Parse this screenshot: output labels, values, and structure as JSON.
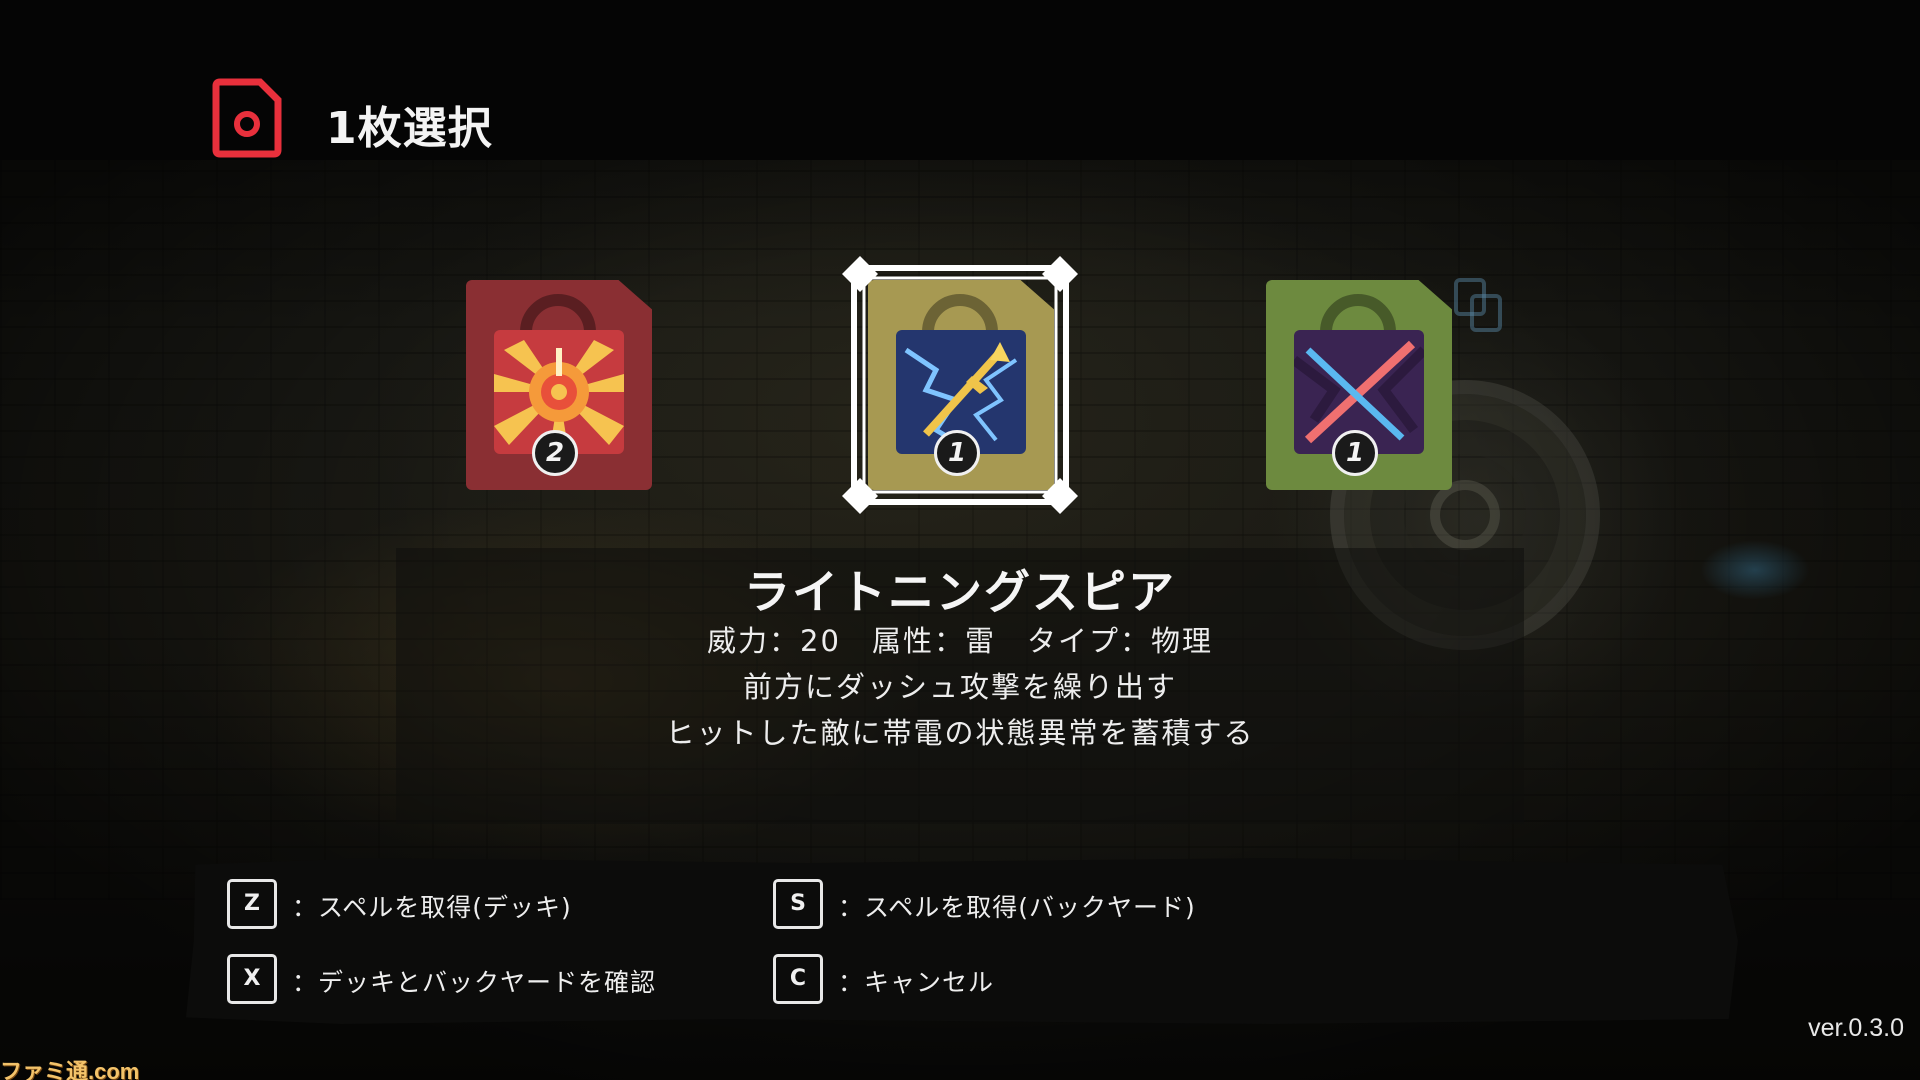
{
  "header": {
    "title": "1枚選択",
    "icon": "card-select-icon",
    "icon_color": "#e8303c"
  },
  "cards": [
    {
      "cost": "2",
      "icon": "sun-burst-spell-icon",
      "color": "#8a2f33",
      "selected": false
    },
    {
      "cost": "1",
      "icon": "lightning-spear-spell-icon",
      "color": "#a79952",
      "selected": true
    },
    {
      "cost": "1",
      "icon": "crossed-slash-spell-icon",
      "color": "#6d8a3f",
      "selected": false
    }
  ],
  "spell": {
    "name": "ライトニングスピア",
    "stats": "威力：20　属性：雷　タイプ：物理",
    "description_1": "前方にダッシュ攻撃を繰り出す",
    "description_2": "ヒットした敵に帯電の状態異常を蓄積する"
  },
  "controls": {
    "z": {
      "key": "Z",
      "label": "：スペルを取得(デッキ)"
    },
    "x": {
      "key": "X",
      "label": "：デッキとバックヤードを確認"
    },
    "s": {
      "key": "S",
      "label": "：スペルを取得(バックヤード)"
    },
    "c": {
      "key": "C",
      "label": "：キャンセル"
    }
  },
  "version": "ver.0.3.0",
  "watermark": "ファミ通.com"
}
